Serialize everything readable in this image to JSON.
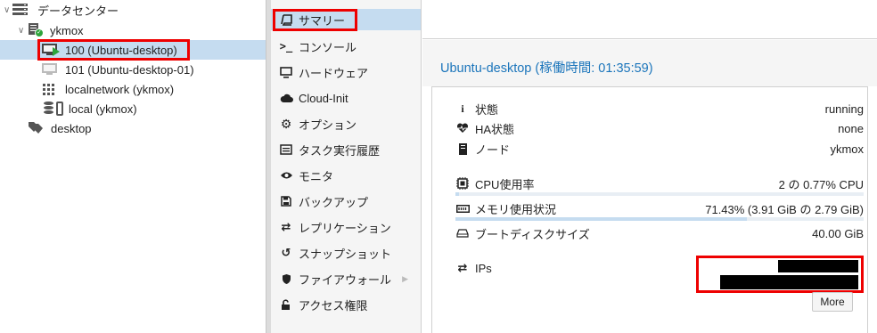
{
  "tree": {
    "datacenter": "データセンター",
    "node": "ykmox",
    "vm_selected": "100 (Ubuntu-desktop)",
    "vm_other": "101 (Ubuntu-desktop-01)",
    "sdn": "localnetwork (ykmox)",
    "storage": "local (ykmox)",
    "tag": "desktop"
  },
  "nav": {
    "items": [
      {
        "label": "サマリー",
        "icon": "book-icon"
      },
      {
        "label": "コンソール",
        "icon": "terminal-icon"
      },
      {
        "label": "ハードウェア",
        "icon": "desktop-icon"
      },
      {
        "label": "Cloud-Init",
        "icon": "cloud-icon"
      },
      {
        "label": "オプション",
        "icon": "gear-icon"
      },
      {
        "label": "タスク実行履歴",
        "icon": "list-icon"
      },
      {
        "label": "モニタ",
        "icon": "eye-icon"
      },
      {
        "label": "バックアップ",
        "icon": "floppy-icon"
      },
      {
        "label": "レプリケーション",
        "icon": "retweet-icon"
      },
      {
        "label": "スナップショット",
        "icon": "history-icon"
      },
      {
        "label": "ファイアウォール",
        "icon": "shield-icon"
      },
      {
        "label": "アクセス権限",
        "icon": "unlock-icon"
      }
    ]
  },
  "summary": {
    "title": "Ubuntu-desktop (稼働時間: 01:35:59)",
    "status_label": "状態",
    "status_value": "running",
    "ha_label": "HA状態",
    "ha_value": "none",
    "node_label": "ノード",
    "node_value": "ykmox",
    "cpu_label": "CPU使用率",
    "cpu_value": "2 の 0.77% CPU",
    "cpu_fraction": 0.0077,
    "mem_label": "メモリ使用状況",
    "mem_value": "71.43% (3.91 GiB の 2.79 GiB)",
    "mem_fraction": 0.7143,
    "disk_label": "ブートディスクサイズ",
    "disk_value": "40.00 GiB",
    "ips_label": "IPs",
    "more_button": "More"
  },
  "colors": {
    "accent": "#1b75bb",
    "selected": "#c5dcf0",
    "highlight_box": "#ee0000",
    "running": "#2ea43a"
  }
}
